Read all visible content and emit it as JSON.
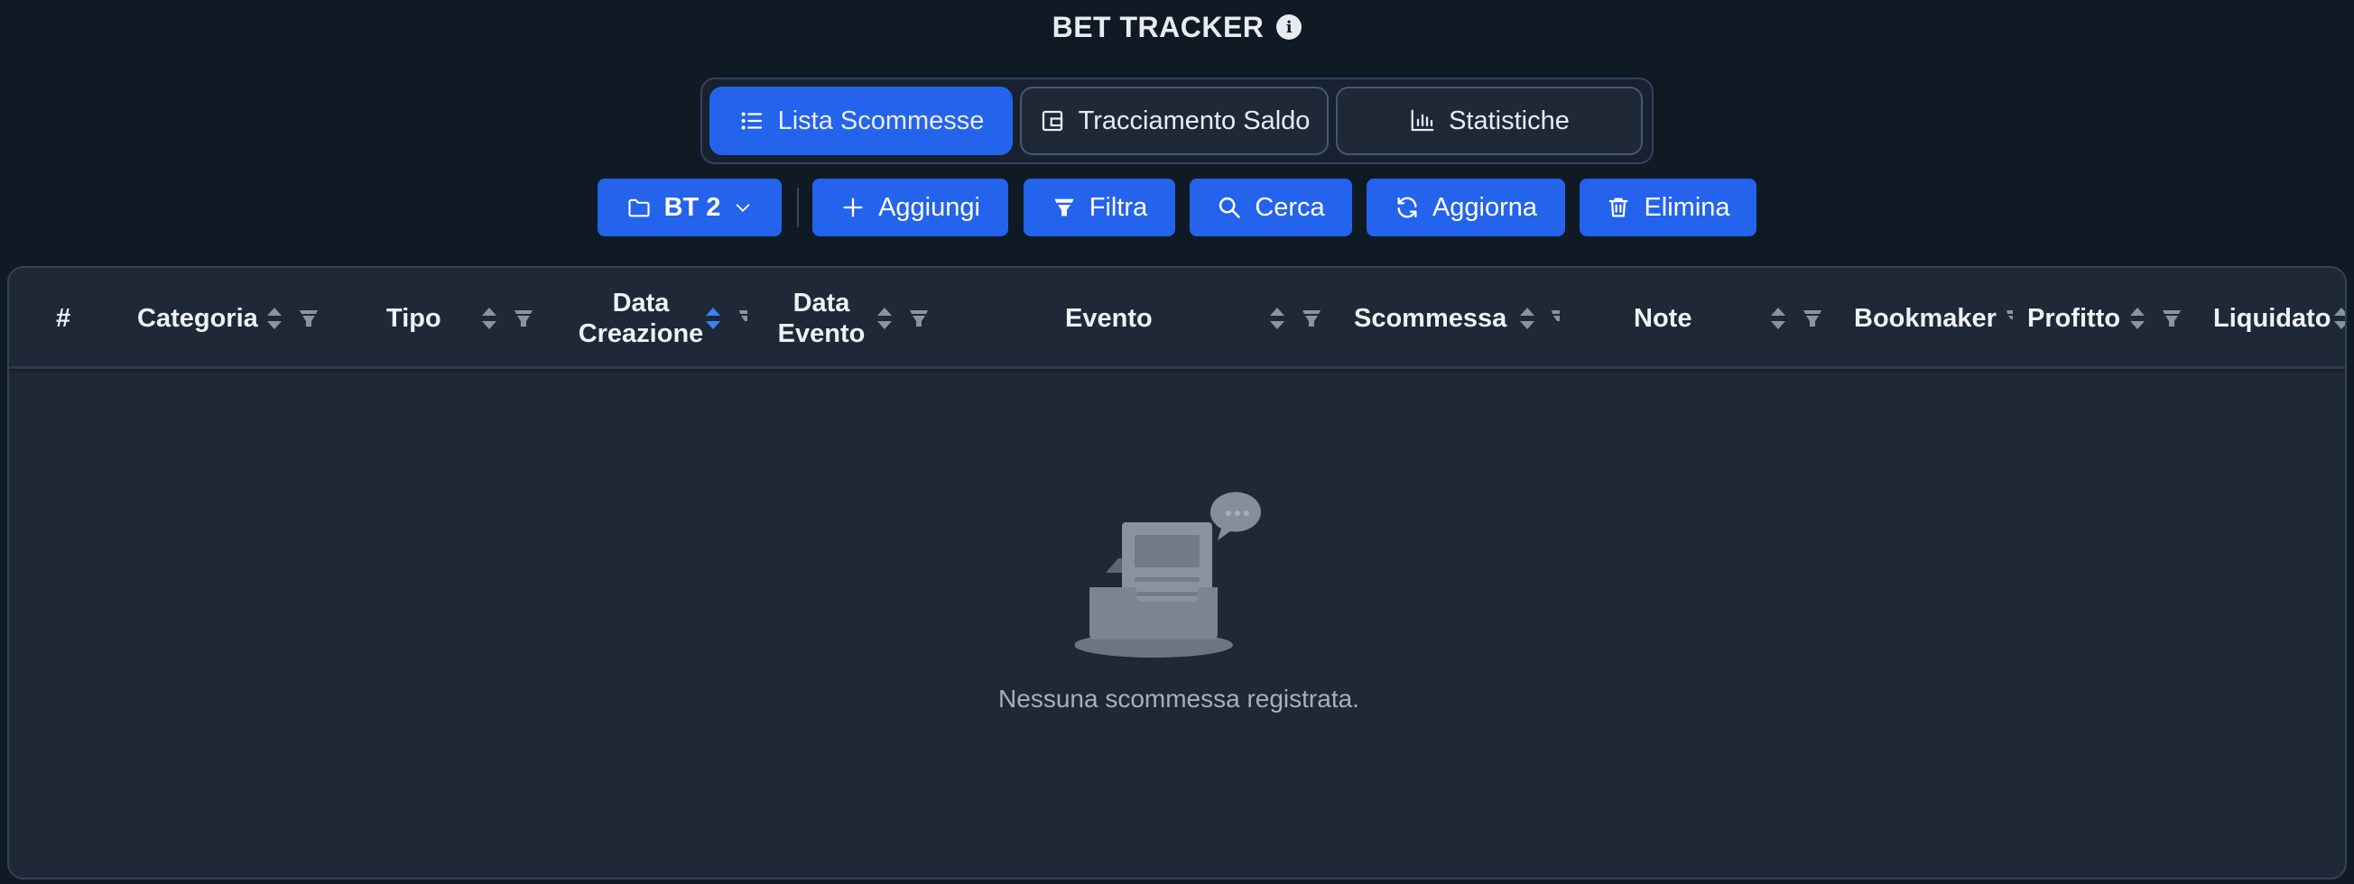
{
  "app": {
    "title": "BET TRACKER"
  },
  "tabs": [
    {
      "label": "Lista Scommesse",
      "icon": "list-icon",
      "active": true
    },
    {
      "label": "Tracciamento Saldo",
      "icon": "wallet-icon",
      "active": false
    },
    {
      "label": "Statistiche",
      "icon": "bar-chart-icon",
      "active": false
    }
  ],
  "toolbar": {
    "folder_label": "BT 2",
    "add_label": "Aggiungi",
    "filter_label": "Filtra",
    "search_label": "Cerca",
    "refresh_label": "Aggiorna",
    "delete_label": "Elimina"
  },
  "table": {
    "columns": {
      "index": "#",
      "categoria": "Categoria",
      "tipo": "Tipo",
      "data_creazione_1": "Data",
      "data_creazione_2": "Creazione",
      "data_evento_1": "Data",
      "data_evento_2": "Evento",
      "evento": "Evento",
      "scommessa": "Scommessa",
      "note": "Note",
      "bookmaker": "Bookmaker",
      "profitto": "Profitto",
      "liquidato": "Liquidato"
    },
    "empty_message": "Nessuna scommessa registrata."
  },
  "colors": {
    "background": "#101a24",
    "accent": "#2463eb",
    "card": "#1e2836",
    "sort_active": "#3b82f6"
  }
}
